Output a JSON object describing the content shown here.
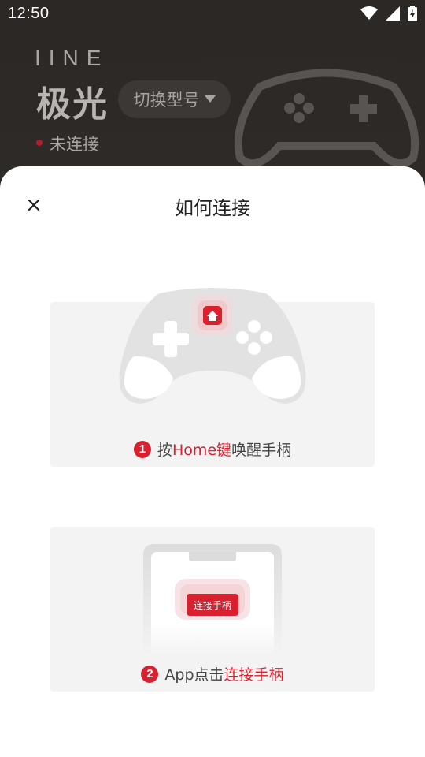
{
  "status_bar": {
    "time": "12:50",
    "icons": [
      "wifi-icon",
      "signal-icon",
      "battery-charging-icon"
    ]
  },
  "header": {
    "brand": "IINE",
    "model_name": "极光",
    "switch_model_label": "切换型号",
    "connection_status": "未连接"
  },
  "sheet": {
    "title": "如何连接",
    "steps": [
      {
        "number": "1",
        "prefix": "按",
        "highlight": "Home键",
        "suffix": "唤醒手柄"
      },
      {
        "number": "2",
        "prefix": "App点击",
        "highlight": "连接手柄",
        "suffix": ""
      }
    ],
    "connect_button_label": "连接手柄"
  },
  "colors": {
    "accent": "#d9202e",
    "sheet_bg": "#ffffff",
    "card_bg": "#f3f3f3",
    "header_bg": "#2c2826"
  }
}
